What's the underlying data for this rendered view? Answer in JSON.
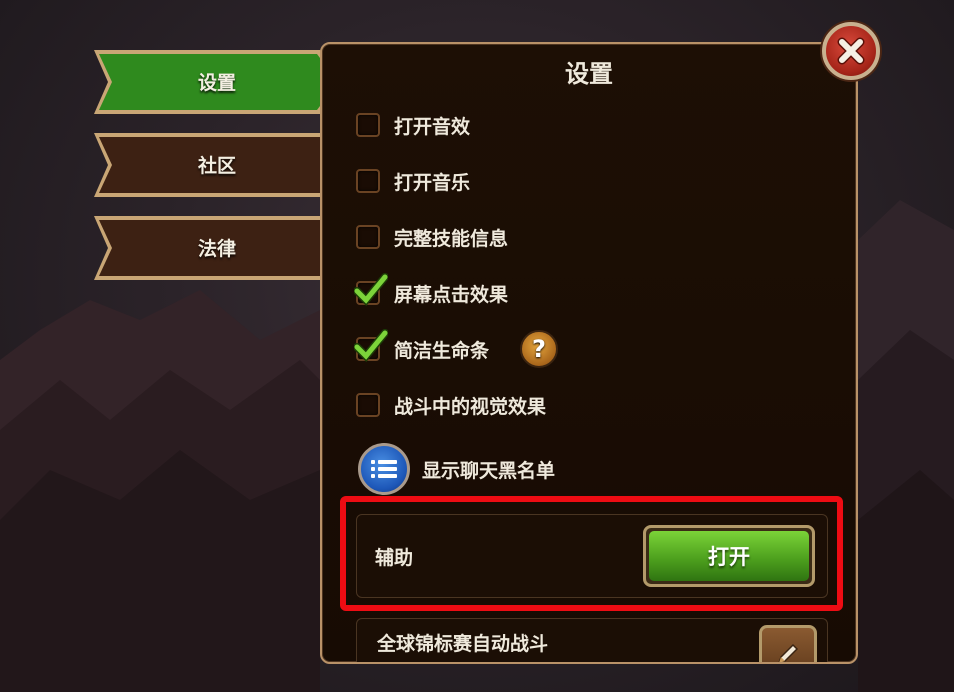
{
  "sidebar": {
    "tabs": [
      {
        "label": "设置",
        "active": true
      },
      {
        "label": "社区",
        "active": false
      },
      {
        "label": "法律",
        "active": false
      }
    ]
  },
  "panel": {
    "title": "设置",
    "options": [
      {
        "label": "打开音效",
        "checked": false
      },
      {
        "label": "打开音乐",
        "checked": false
      },
      {
        "label": "完整技能信息",
        "checked": false
      },
      {
        "label": "屏幕点击效果",
        "checked": true
      },
      {
        "label": "简洁生命条",
        "checked": true
      },
      {
        "label": "战斗中的视觉效果",
        "checked": false
      }
    ],
    "help_glyph": "?",
    "chat_blacklist_label": "显示聊天黑名单",
    "assist": {
      "label": "辅助",
      "button_label": "打开"
    },
    "tournament": {
      "label": "全球锦标赛自动战斗"
    }
  },
  "icons": {
    "close": "close-icon",
    "help": "question-icon",
    "list": "list-icon",
    "edit": "pencil-icon",
    "check": "checkmark-icon"
  },
  "colors": {
    "active_tab": "#2f8a1e",
    "inactive_tab": "#3d2113",
    "panel_border": "#b99268",
    "highlight": "#ee0c13",
    "open_button": "#5fb82a"
  }
}
